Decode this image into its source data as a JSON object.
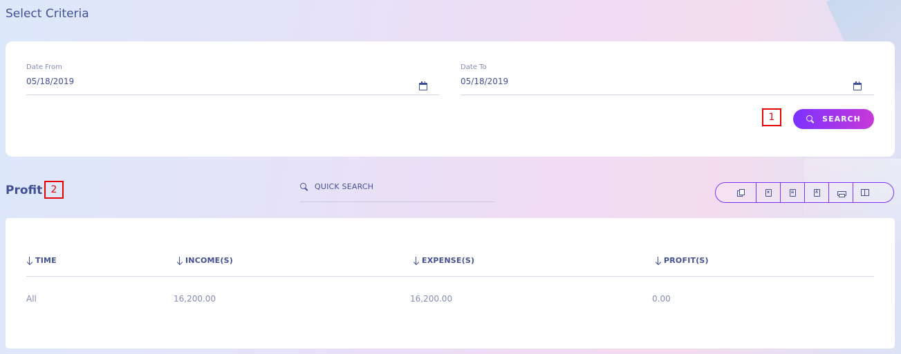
{
  "criteria": {
    "title": "Select Criteria",
    "date_from": {
      "label": "Date From",
      "value": "05/18/2019",
      "icon": "calendar-icon"
    },
    "date_to": {
      "label": "Date To",
      "value": "05/18/2019",
      "icon": "calendar-icon"
    },
    "search_button": {
      "label": "SEARCH",
      "icon": "search-icon"
    }
  },
  "markers": {
    "one": "1",
    "two": "2"
  },
  "profit": {
    "title": "Profit",
    "quick_search": {
      "placeholder": "QUICK SEARCH",
      "icon": "search-icon"
    },
    "toolbar": [
      {
        "name": "copy-icon"
      },
      {
        "name": "excel-icon",
        "glyph": "x"
      },
      {
        "name": "csv-icon",
        "glyph": "≡"
      },
      {
        "name": "pdf-icon",
        "glyph": "ʎ"
      },
      {
        "name": "print-icon"
      },
      {
        "name": "columns-icon"
      }
    ],
    "columns": [
      "TIME",
      "INCOME(S)",
      "EXPENSE(S)",
      "PROFIT(S)"
    ],
    "rows": [
      {
        "time": "All",
        "income": "16,200.00",
        "expense": "16,200.00",
        "profit": "0.00"
      }
    ]
  },
  "colors": {
    "primary_text": "#415094",
    "muted_text": "#828bb2",
    "accent_start": "#7c32ff",
    "accent_end": "#c738d8",
    "marker": "#e60000"
  }
}
